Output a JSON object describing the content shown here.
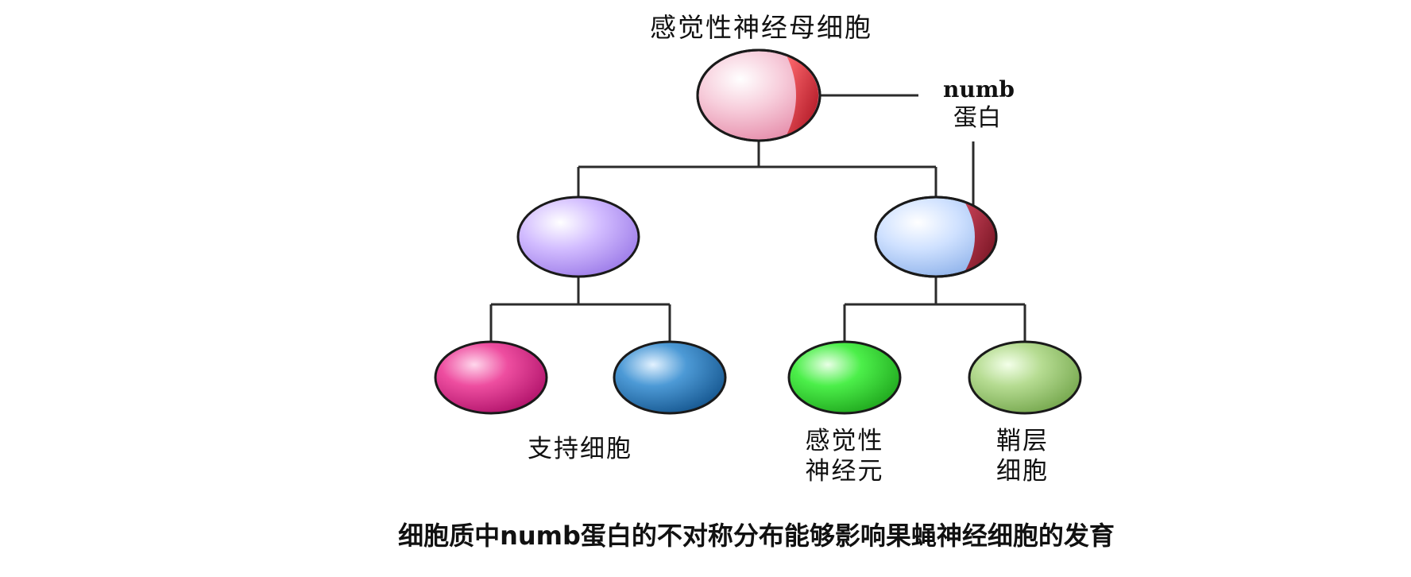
{
  "diagram": {
    "title": "感觉性神经母细胞",
    "numb_label_line1": "numb",
    "numb_label_line2": "蛋白",
    "support_cells_label": "支持细胞",
    "sensory_neuron_line1": "感觉性",
    "sensory_neuron_line2": "神经元",
    "sheath_cell_line1": "鞘层",
    "sheath_cell_line2": "细胞",
    "caption": "细胞质中numb蛋白的不对称分布能够影响果蝇神经细胞的发育"
  },
  "colors": {
    "root_cell": "#f2b3c8",
    "numb_crescent": "#d0202f",
    "left_cell": "#c3a6ff",
    "right_cell": "#b8d4ff",
    "right_crescent": "#9e1c2e",
    "support_cell_a": "#e0207f",
    "support_cell_b": "#2a7fc0",
    "sensory_neuron": "#36e03a",
    "sheath_cell": "#a4d47c",
    "connector": "#2b2b2b"
  }
}
